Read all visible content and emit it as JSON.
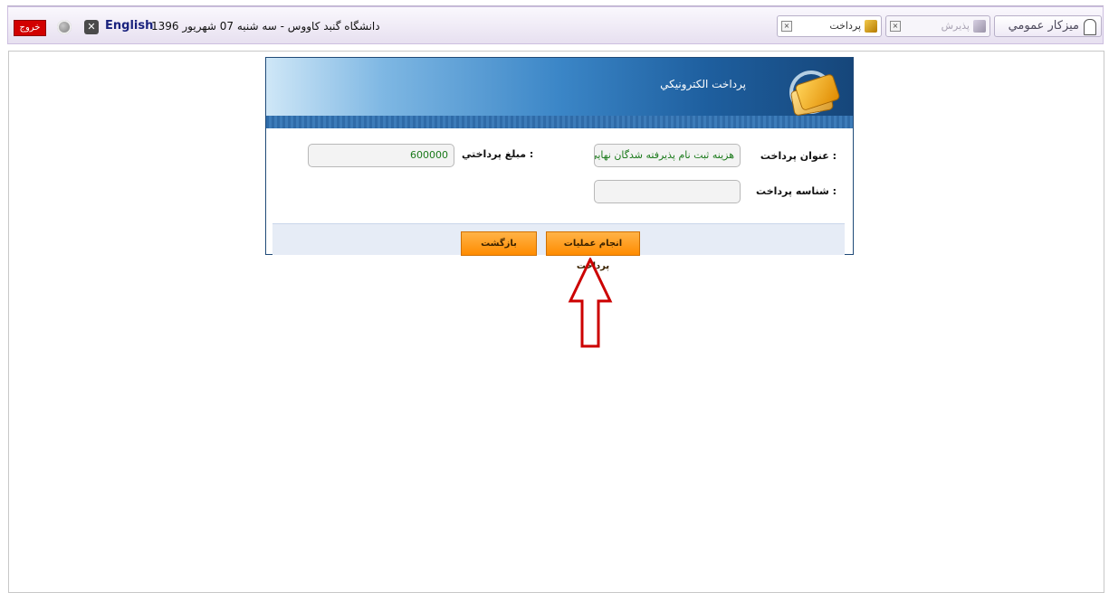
{
  "topbar": {
    "exit_label": "خروج",
    "language_label": "English",
    "date_text": "دانشگاه گنبد کاووس - سه شنبه 07 شهریور 1396"
  },
  "tabs": [
    {
      "label": "پرداخت",
      "close": "×"
    },
    {
      "label": "پذيرش",
      "close": "×"
    },
    {
      "label": "ميزكار عمومي"
    }
  ],
  "panel": {
    "title": "پرداخت الكترونيكي",
    "payment_title_label": "عنوان پرداخت :",
    "payment_title_value": "هزینه ثبت نام پذیرفته شدگان نهایی دکتری",
    "payment_id_label": "شناسه پرداخت :",
    "payment_id_value": "",
    "amount_label": "مبلغ پرداختي :",
    "amount_value": "600000",
    "pay_button": "انجام عمليات پرداخت",
    "back_button": "بازگشت"
  },
  "colors": {
    "exit_bg": "#d20000",
    "button_orange": "#ff8c00",
    "banner_dark": "#16467a",
    "arrow_red": "#cc0000",
    "value_green": "#1b7a1b"
  }
}
